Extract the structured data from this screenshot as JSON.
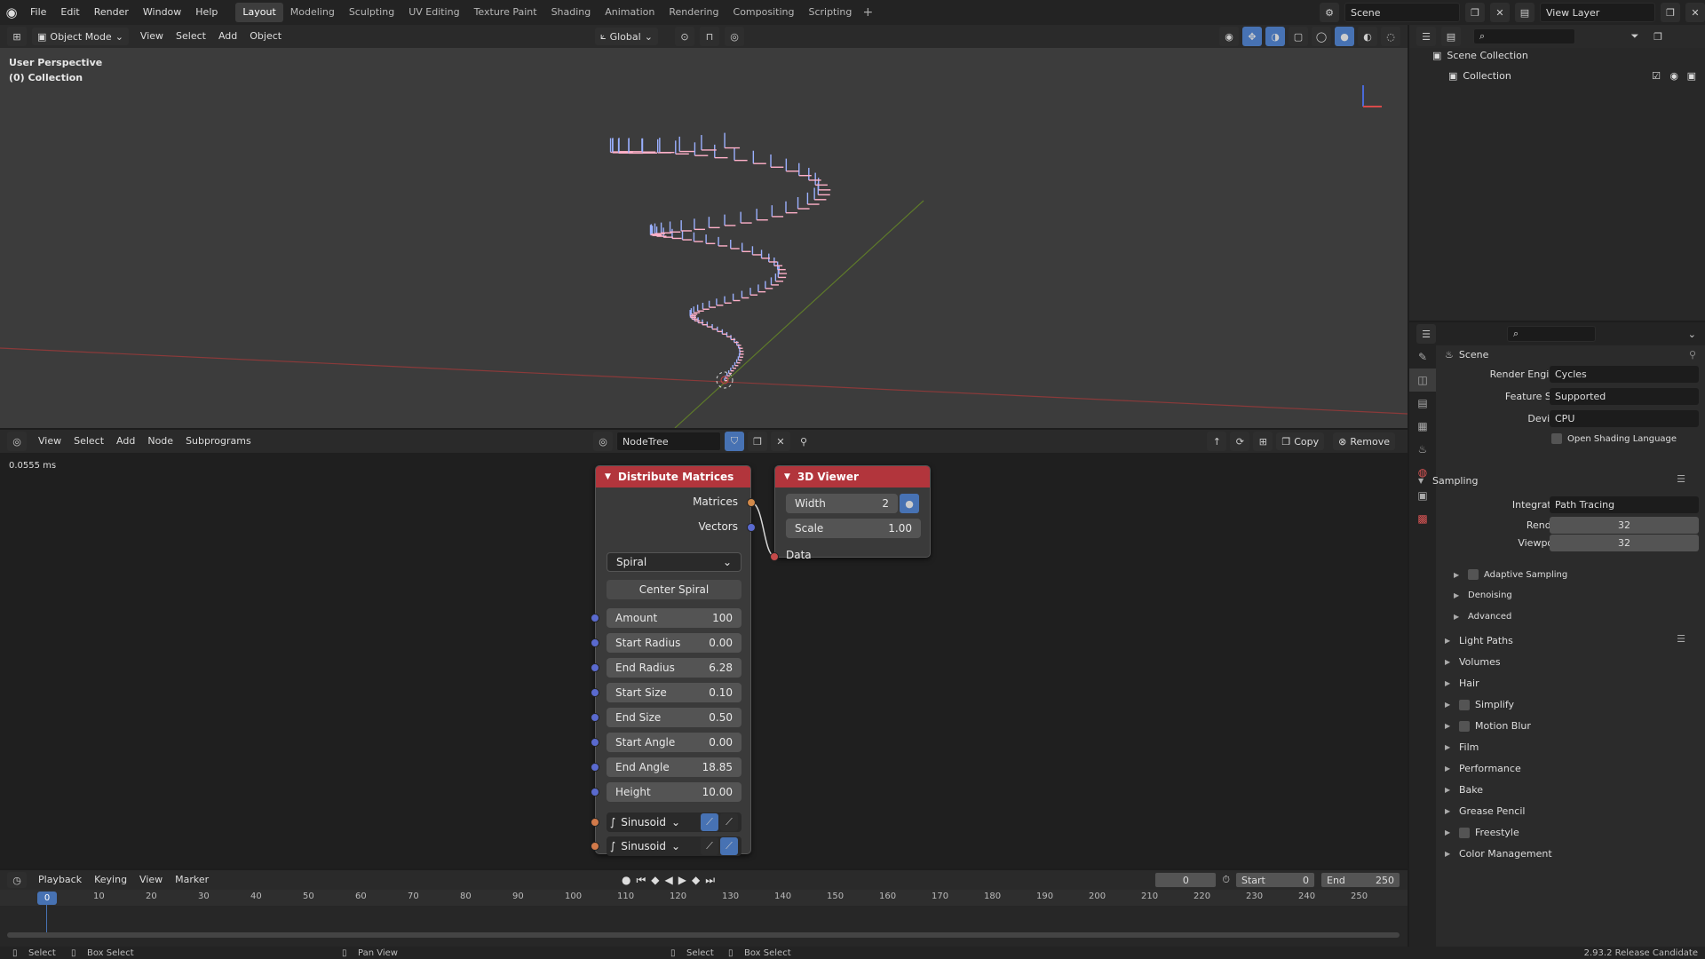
{
  "topbar": {
    "menus": [
      "File",
      "Edit",
      "Render",
      "Window",
      "Help"
    ],
    "workspaces": [
      "Layout",
      "Modeling",
      "Sculpting",
      "UV Editing",
      "Texture Paint",
      "Shading",
      "Animation",
      "Rendering",
      "Compositing",
      "Scripting"
    ],
    "active_workspace": "Layout",
    "scene": "Scene",
    "view_layer": "View Layer"
  },
  "viewport": {
    "mode": "Object Mode",
    "menus": [
      "View",
      "Select",
      "Add",
      "Object"
    ],
    "orientation": "Global",
    "overlay_line1": "User Perspective",
    "overlay_line2": "(0) Collection"
  },
  "node_editor": {
    "menus": [
      "View",
      "Select",
      "Add",
      "Node",
      "Subprograms"
    ],
    "tree_name": "NodeTree",
    "copy_label": "Copy",
    "remove_label": "Remove",
    "timing": "0.0555 ms",
    "distribute": {
      "title": "Distribute Matrices",
      "out_matrices": "Matrices",
      "out_vectors": "Vectors",
      "mode": "Spiral",
      "center_button": "Center Spiral",
      "fields": [
        {
          "label": "Amount",
          "value": "100"
        },
        {
          "label": "Start Radius",
          "value": "0.00"
        },
        {
          "label": "End Radius",
          "value": "6.28"
        },
        {
          "label": "Start Size",
          "value": "0.10"
        },
        {
          "label": "End Size",
          "value": "0.50"
        },
        {
          "label": "Start Angle",
          "value": "0.00"
        },
        {
          "label": "End Angle",
          "value": "18.85"
        },
        {
          "label": "Height",
          "value": "10.00"
        }
      ],
      "curve1": "Sinusoid",
      "curve2": "Sinusoid"
    },
    "viewer": {
      "title": "3D Viewer",
      "width_label": "Width",
      "width_value": "2",
      "scale_label": "Scale",
      "scale_value": "1.00",
      "in_data": "Data"
    }
  },
  "timeline": {
    "menus": [
      "Playback",
      "Keying",
      "View",
      "Marker"
    ],
    "current_frame": "0",
    "start_label": "Start",
    "start_value": "0",
    "end_label": "End",
    "end_value": "250",
    "ticks": [
      "0",
      "10",
      "20",
      "30",
      "40",
      "50",
      "60",
      "70",
      "80",
      "90",
      "100",
      "110",
      "120",
      "130",
      "140",
      "150",
      "160",
      "170",
      "180",
      "190",
      "200",
      "210",
      "220",
      "230",
      "240",
      "250"
    ]
  },
  "outliner": {
    "root": "Scene Collection",
    "child": "Collection"
  },
  "properties": {
    "context": "Scene",
    "render_engine_label": "Render Engine",
    "render_engine": "Cycles",
    "feature_set_label": "Feature Set",
    "feature_set": "Supported",
    "device_label": "Device",
    "device": "CPU",
    "osl_label": "Open Shading Language",
    "sampling": "Sampling",
    "integrator_label": "Integrator",
    "integrator": "Path Tracing",
    "render_label": "Render",
    "render_samples": "32",
    "viewport_label": "Viewport",
    "viewport_samples": "32",
    "sub_panels": [
      "Adaptive Sampling",
      "Denoising",
      "Advanced"
    ],
    "panels": [
      "Light Paths",
      "Volumes",
      "Hair",
      "Simplify",
      "Motion Blur",
      "Film",
      "Performance",
      "Bake",
      "Grease Pencil",
      "Freestyle",
      "Color Management"
    ]
  },
  "status": {
    "left_select": "Select",
    "left_box": "Box Select",
    "mid_pan": "Pan View",
    "right_select": "Select",
    "right_box": "Box Select",
    "version": "2.93.2 Release Candidate"
  }
}
